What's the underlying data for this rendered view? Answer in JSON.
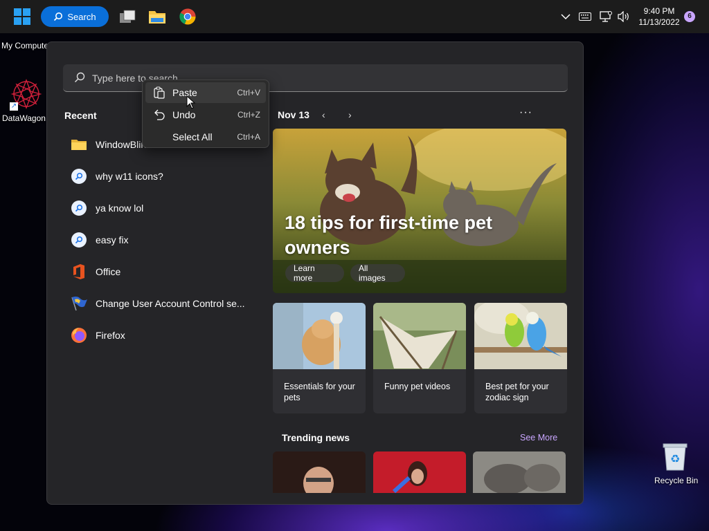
{
  "taskbar": {
    "search_label": "Search",
    "clock_time": "9:40 PM",
    "clock_date": "11/13/2022",
    "notification_count": "6"
  },
  "desktop": {
    "icons": [
      {
        "label": "My Computer"
      },
      {
        "label": "DataWagon..."
      },
      {
        "label": "Recycle Bin"
      }
    ]
  },
  "start": {
    "search_placeholder": "Type here to search",
    "recent_title": "Recent",
    "recent_items": [
      {
        "label": "WindowBlinds",
        "icon": "folder-icon"
      },
      {
        "label": "why w11 icons?",
        "icon": "web-search-icon"
      },
      {
        "label": "ya know lol",
        "icon": "web-search-icon"
      },
      {
        "label": "easy fix",
        "icon": "web-search-icon"
      },
      {
        "label": "Office",
        "icon": "office-icon"
      },
      {
        "label": "Change User Account Control se...",
        "icon": "uac-flag-icon"
      },
      {
        "label": "Firefox",
        "icon": "firefox-icon"
      }
    ],
    "date": "Nov 13",
    "more": "···",
    "hero": {
      "title": "18 tips for first-time pet owners",
      "learn_more": "Learn more",
      "all_images": "All images"
    },
    "cards": [
      {
        "caption": "Essentials for your pets"
      },
      {
        "caption": "Funny pet videos"
      },
      {
        "caption": "Best pet for your zodiac sign"
      }
    ],
    "trending_title": "Trending news",
    "see_more": "See More"
  },
  "context_menu": {
    "items": [
      {
        "label": "Paste",
        "shortcut": "Ctrl+V"
      },
      {
        "label": "Undo",
        "shortcut": "Ctrl+Z"
      },
      {
        "label": "Select All",
        "shortcut": "Ctrl+A"
      }
    ]
  },
  "colors": {
    "accent": "#0a6fd9",
    "panel": "#252528",
    "link": "#c9a6ff",
    "windows_blue": "#2aa1f3"
  }
}
